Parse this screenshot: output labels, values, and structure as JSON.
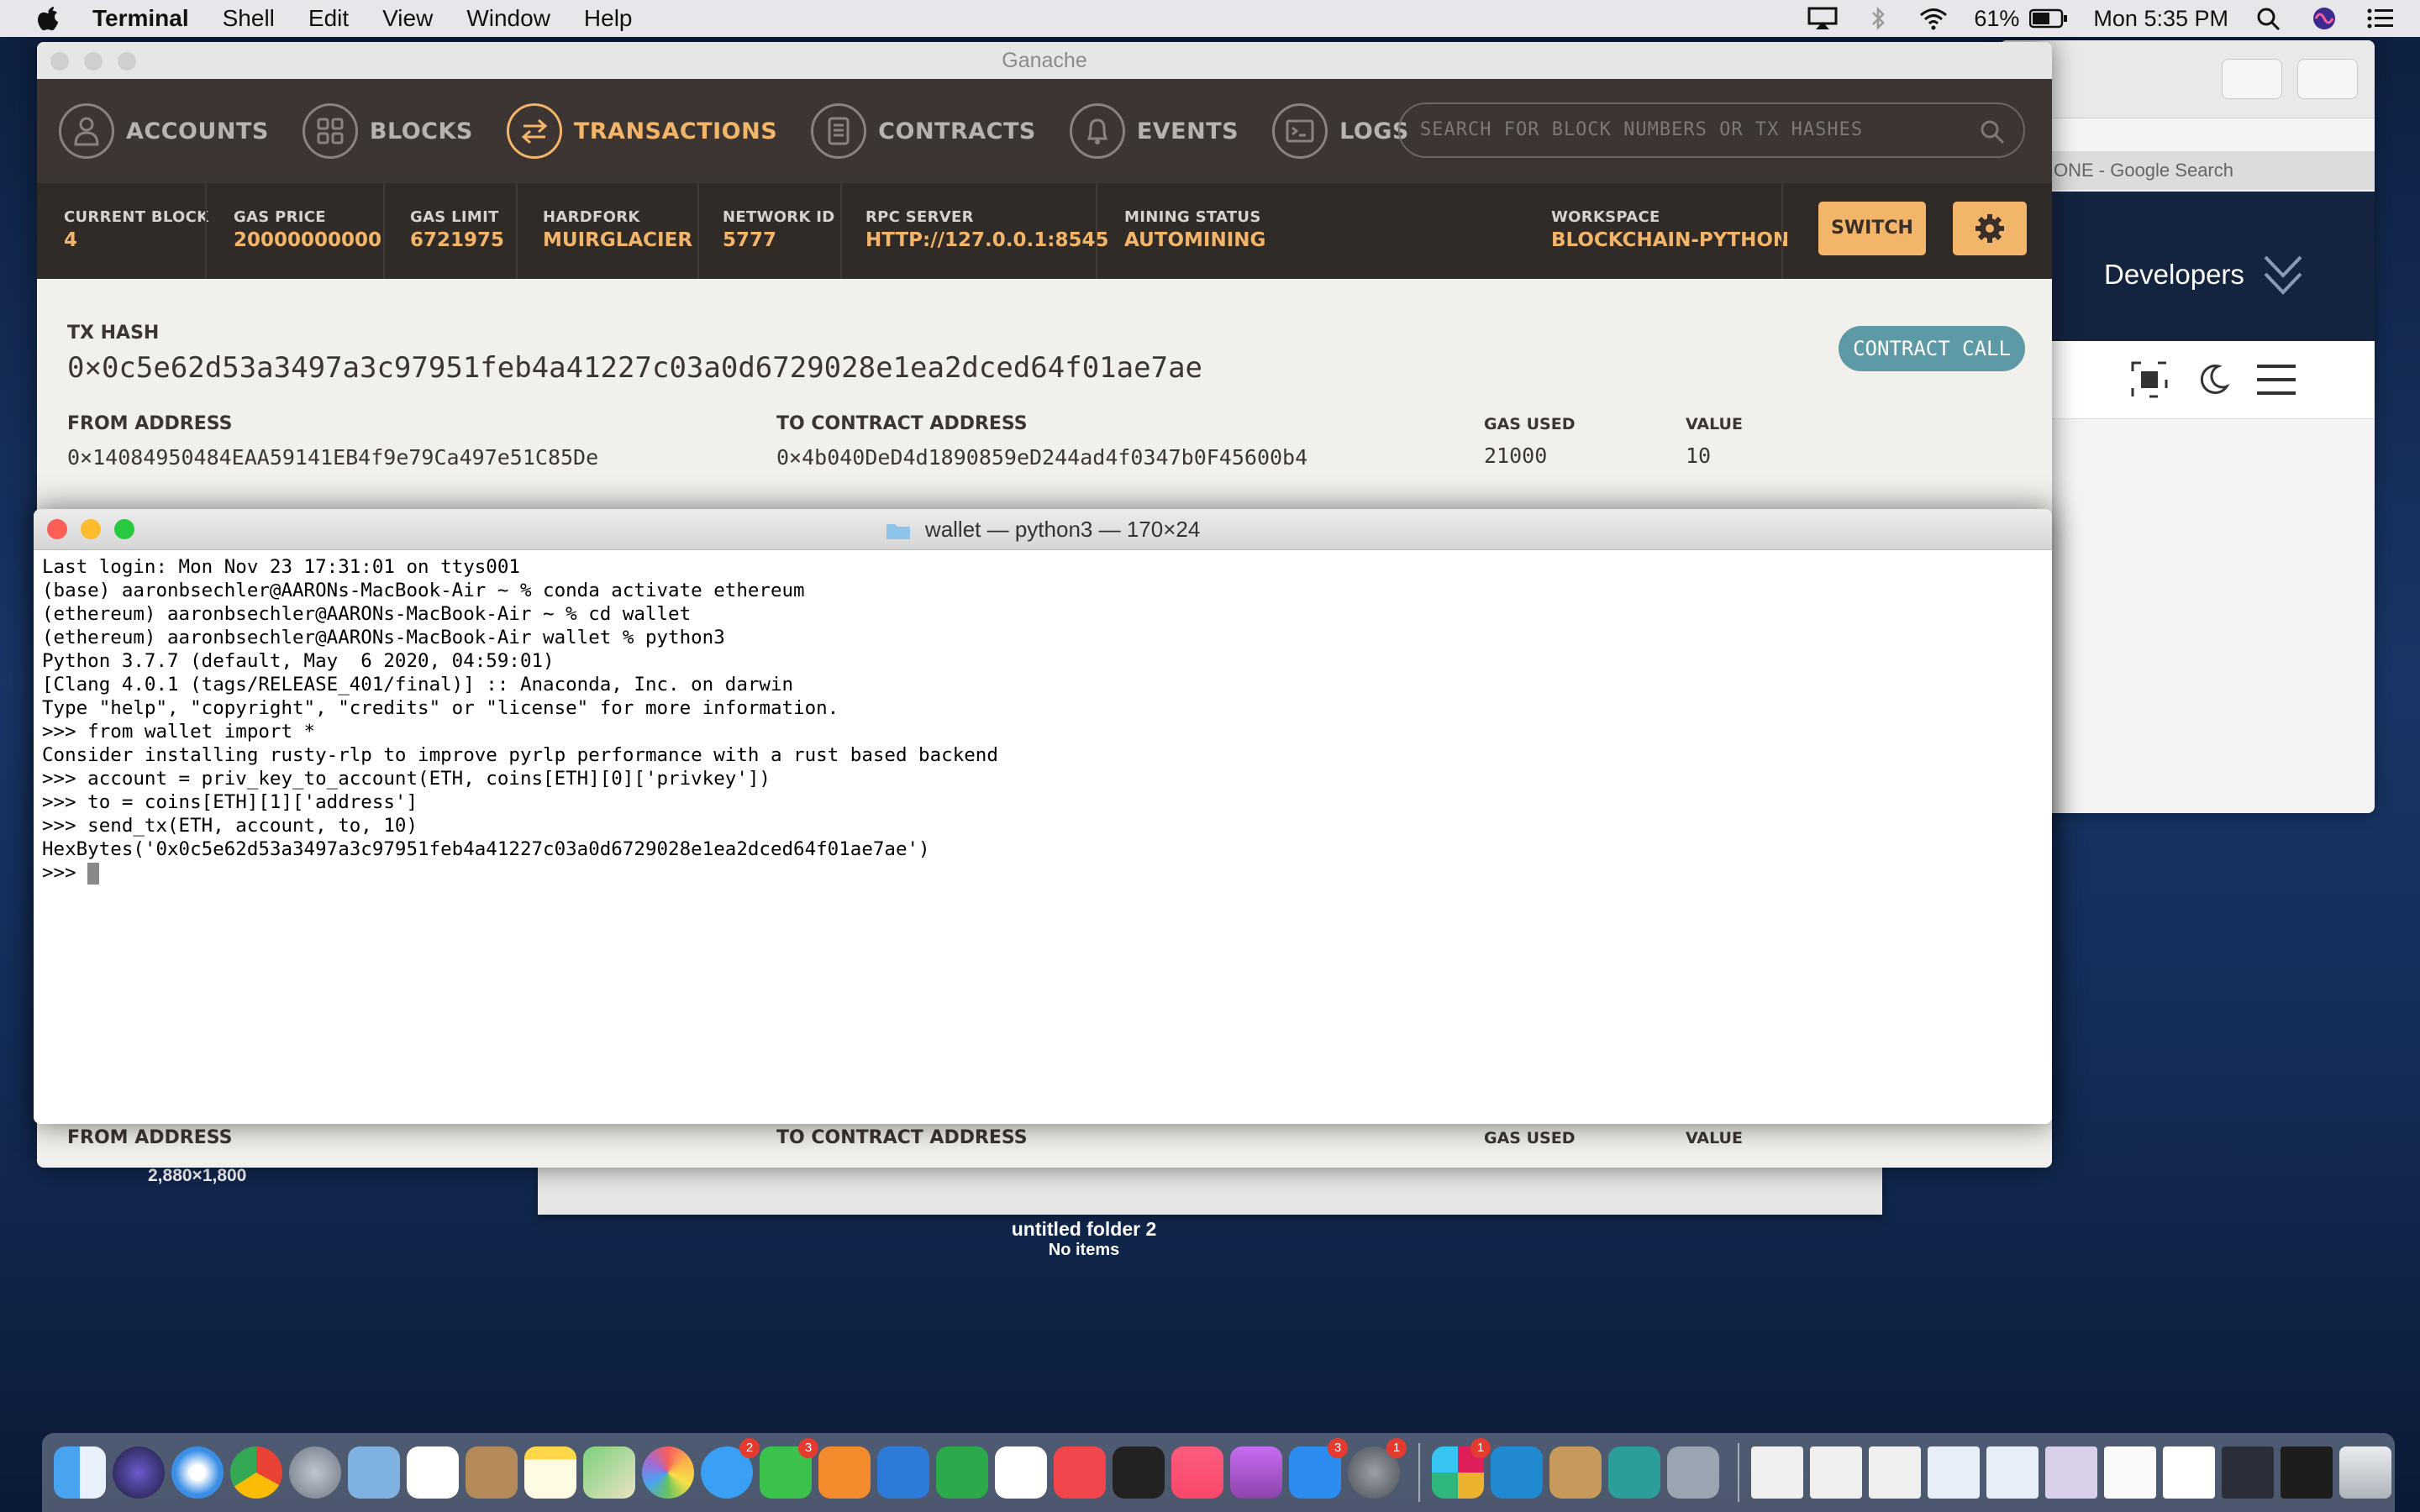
{
  "menubar": {
    "app": "Terminal",
    "items": [
      "Shell",
      "Edit",
      "View",
      "Window",
      "Help"
    ],
    "battery": "61%",
    "clock": "Mon 5:35 PM"
  },
  "safari": {
    "tab_label": "ONE - Google Search",
    "developers_label": "Developers"
  },
  "ganache": {
    "window_title": "Ganache",
    "nav": {
      "accounts": "ACCOUNTS",
      "blocks": "BLOCKS",
      "transactions": "TRANSACTIONS",
      "contracts": "CONTRACTS",
      "events": "EVENTS",
      "logs": "LOGS"
    },
    "search_placeholder": "SEARCH FOR BLOCK NUMBERS OR TX HASHES",
    "stats": {
      "current_block": {
        "label": "CURRENT BLOCK",
        "value": "4"
      },
      "gas_price": {
        "label": "GAS PRICE",
        "value": "20000000000"
      },
      "gas_limit": {
        "label": "GAS LIMIT",
        "value": "6721975"
      },
      "hardfork": {
        "label": "HARDFORK",
        "value": "MUIRGLACIER"
      },
      "network_id": {
        "label": "NETWORK ID",
        "value": "5777"
      },
      "rpc_server": {
        "label": "RPC SERVER",
        "value": "HTTP://127.0.0.1:8545"
      },
      "mining_status": {
        "label": "MINING STATUS",
        "value": "AUTOMINING"
      },
      "workspace": {
        "label": "WORKSPACE",
        "value": "BLOCKCHAIN-PYTHON"
      }
    },
    "switch_label": "SWITCH",
    "tx": {
      "hash_label": "TX HASH",
      "hash": "0×0c5e62d53a3497a3c97951feb4a41227c03a0d6729028e1ea2dced64f01ae7ae",
      "badge": "CONTRACT CALL",
      "from_label": "FROM ADDRESS",
      "from": "0×14084950484EAA59141EB4f9e79Ca497e51C85De",
      "to_label": "TO CONTRACT ADDRESS",
      "to": "0×4b040DeD4d1890859eD244ad4f0347b0F45600b4",
      "gas_used_label": "GAS USED",
      "gas_used": "21000",
      "value_label": "VALUE",
      "value": "10"
    },
    "repeat": {
      "from_label": "FROM ADDRESS",
      "to_label": "TO CONTRACT ADDRESS",
      "gas_used_label": "GAS USED",
      "value_label": "VALUE"
    }
  },
  "terminal": {
    "title": "wallet — python3 — 170×24",
    "lines": [
      "Last login: Mon Nov 23 17:31:01 on ttys001",
      "(base) aaronbsechler@AARONs-MacBook-Air ~ % conda activate ethereum",
      "(ethereum) aaronbsechler@AARONs-MacBook-Air ~ % cd wallet",
      "(ethereum) aaronbsechler@AARONs-MacBook-Air wallet % python3",
      "Python 3.7.7 (default, May  6 2020, 04:59:01)",
      "[Clang 4.0.1 (tags/RELEASE_401/final)] :: Anaconda, Inc. on darwin",
      "Type \"help\", \"copyright\", \"credits\" or \"license\" for more information.",
      ">>> from wallet import *",
      "Consider installing rusty-rlp to improve pyrlp performance with a rust based backend",
      ">>> account = priv_key_to_account(ETH, coins[ETH][0]['privkey'])",
      ">>> to = coins[ETH][1]['address']",
      ">>> send_tx(ETH, account, to, 10)",
      "HexBytes('0x0c5e62d53a3497a3c97951feb4a41227c03a0d6729028e1ea2dced64f01ae7ae')"
    ],
    "prompt": ">>> "
  },
  "desktop": {
    "screenshot_size": "2,880×1,800",
    "folder_name": "untitled folder 2",
    "folder_items": "No items"
  },
  "dock": {
    "badges": {
      "messages": "2",
      "facetime": "3",
      "appstore": "3",
      "prefs": "1",
      "slack": "1"
    }
  }
}
